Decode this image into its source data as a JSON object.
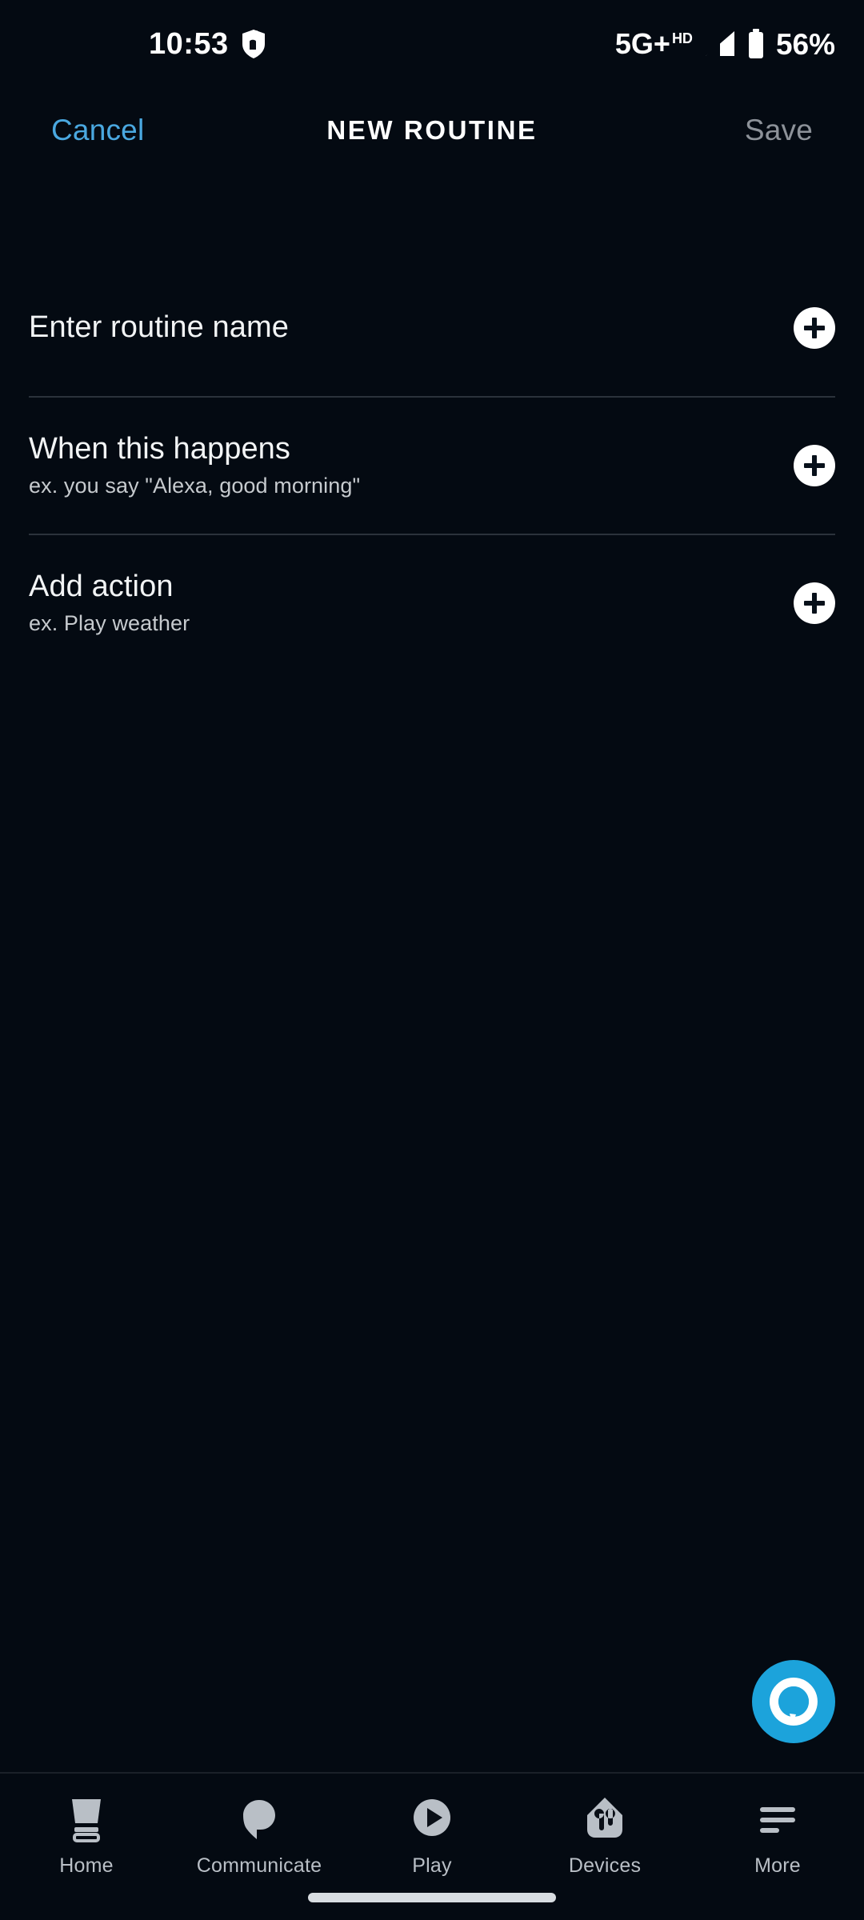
{
  "status_bar": {
    "time": "10:53",
    "privacy_icon": "shield-hand-icon",
    "network": "5G",
    "network_plus": "+",
    "network_hd": "HD",
    "signal_icon": "signal-bars-icon",
    "battery_icon": "battery-icon",
    "battery_percent": "56%"
  },
  "header": {
    "cancel_label": "Cancel",
    "title": "NEW ROUTINE",
    "save_label": "Save",
    "cancel_color": "#4aa8e0",
    "save_color": "#8d9299"
  },
  "rows": [
    {
      "title": "Enter routine name",
      "subtitle": "",
      "add_icon": "plus-icon"
    },
    {
      "title": "When this happens",
      "subtitle": "ex. you say \"Alexa, good morning\"",
      "add_icon": "plus-icon"
    },
    {
      "title": "Add action",
      "subtitle": "ex. Play weather",
      "add_icon": "plus-icon"
    }
  ],
  "fab": {
    "icon": "alexa-logo-icon",
    "color": "#1ca3db"
  },
  "bottom_nav": {
    "items": [
      {
        "label": "Home",
        "icon": "echo-show-device-icon"
      },
      {
        "label": "Communicate",
        "icon": "speech-bubble-icon"
      },
      {
        "label": "Play",
        "icon": "play-circle-icon"
      },
      {
        "label": "Devices",
        "icon": "smart-home-house-icon"
      },
      {
        "label": "More",
        "icon": "hamburger-menu-icon"
      }
    ],
    "inactive_color": "#b9bfc6"
  },
  "theme": {
    "background": "#040a12",
    "divider": "#2b323b",
    "text_primary": "#f2f4f5",
    "text_secondary": "#c6cace"
  }
}
